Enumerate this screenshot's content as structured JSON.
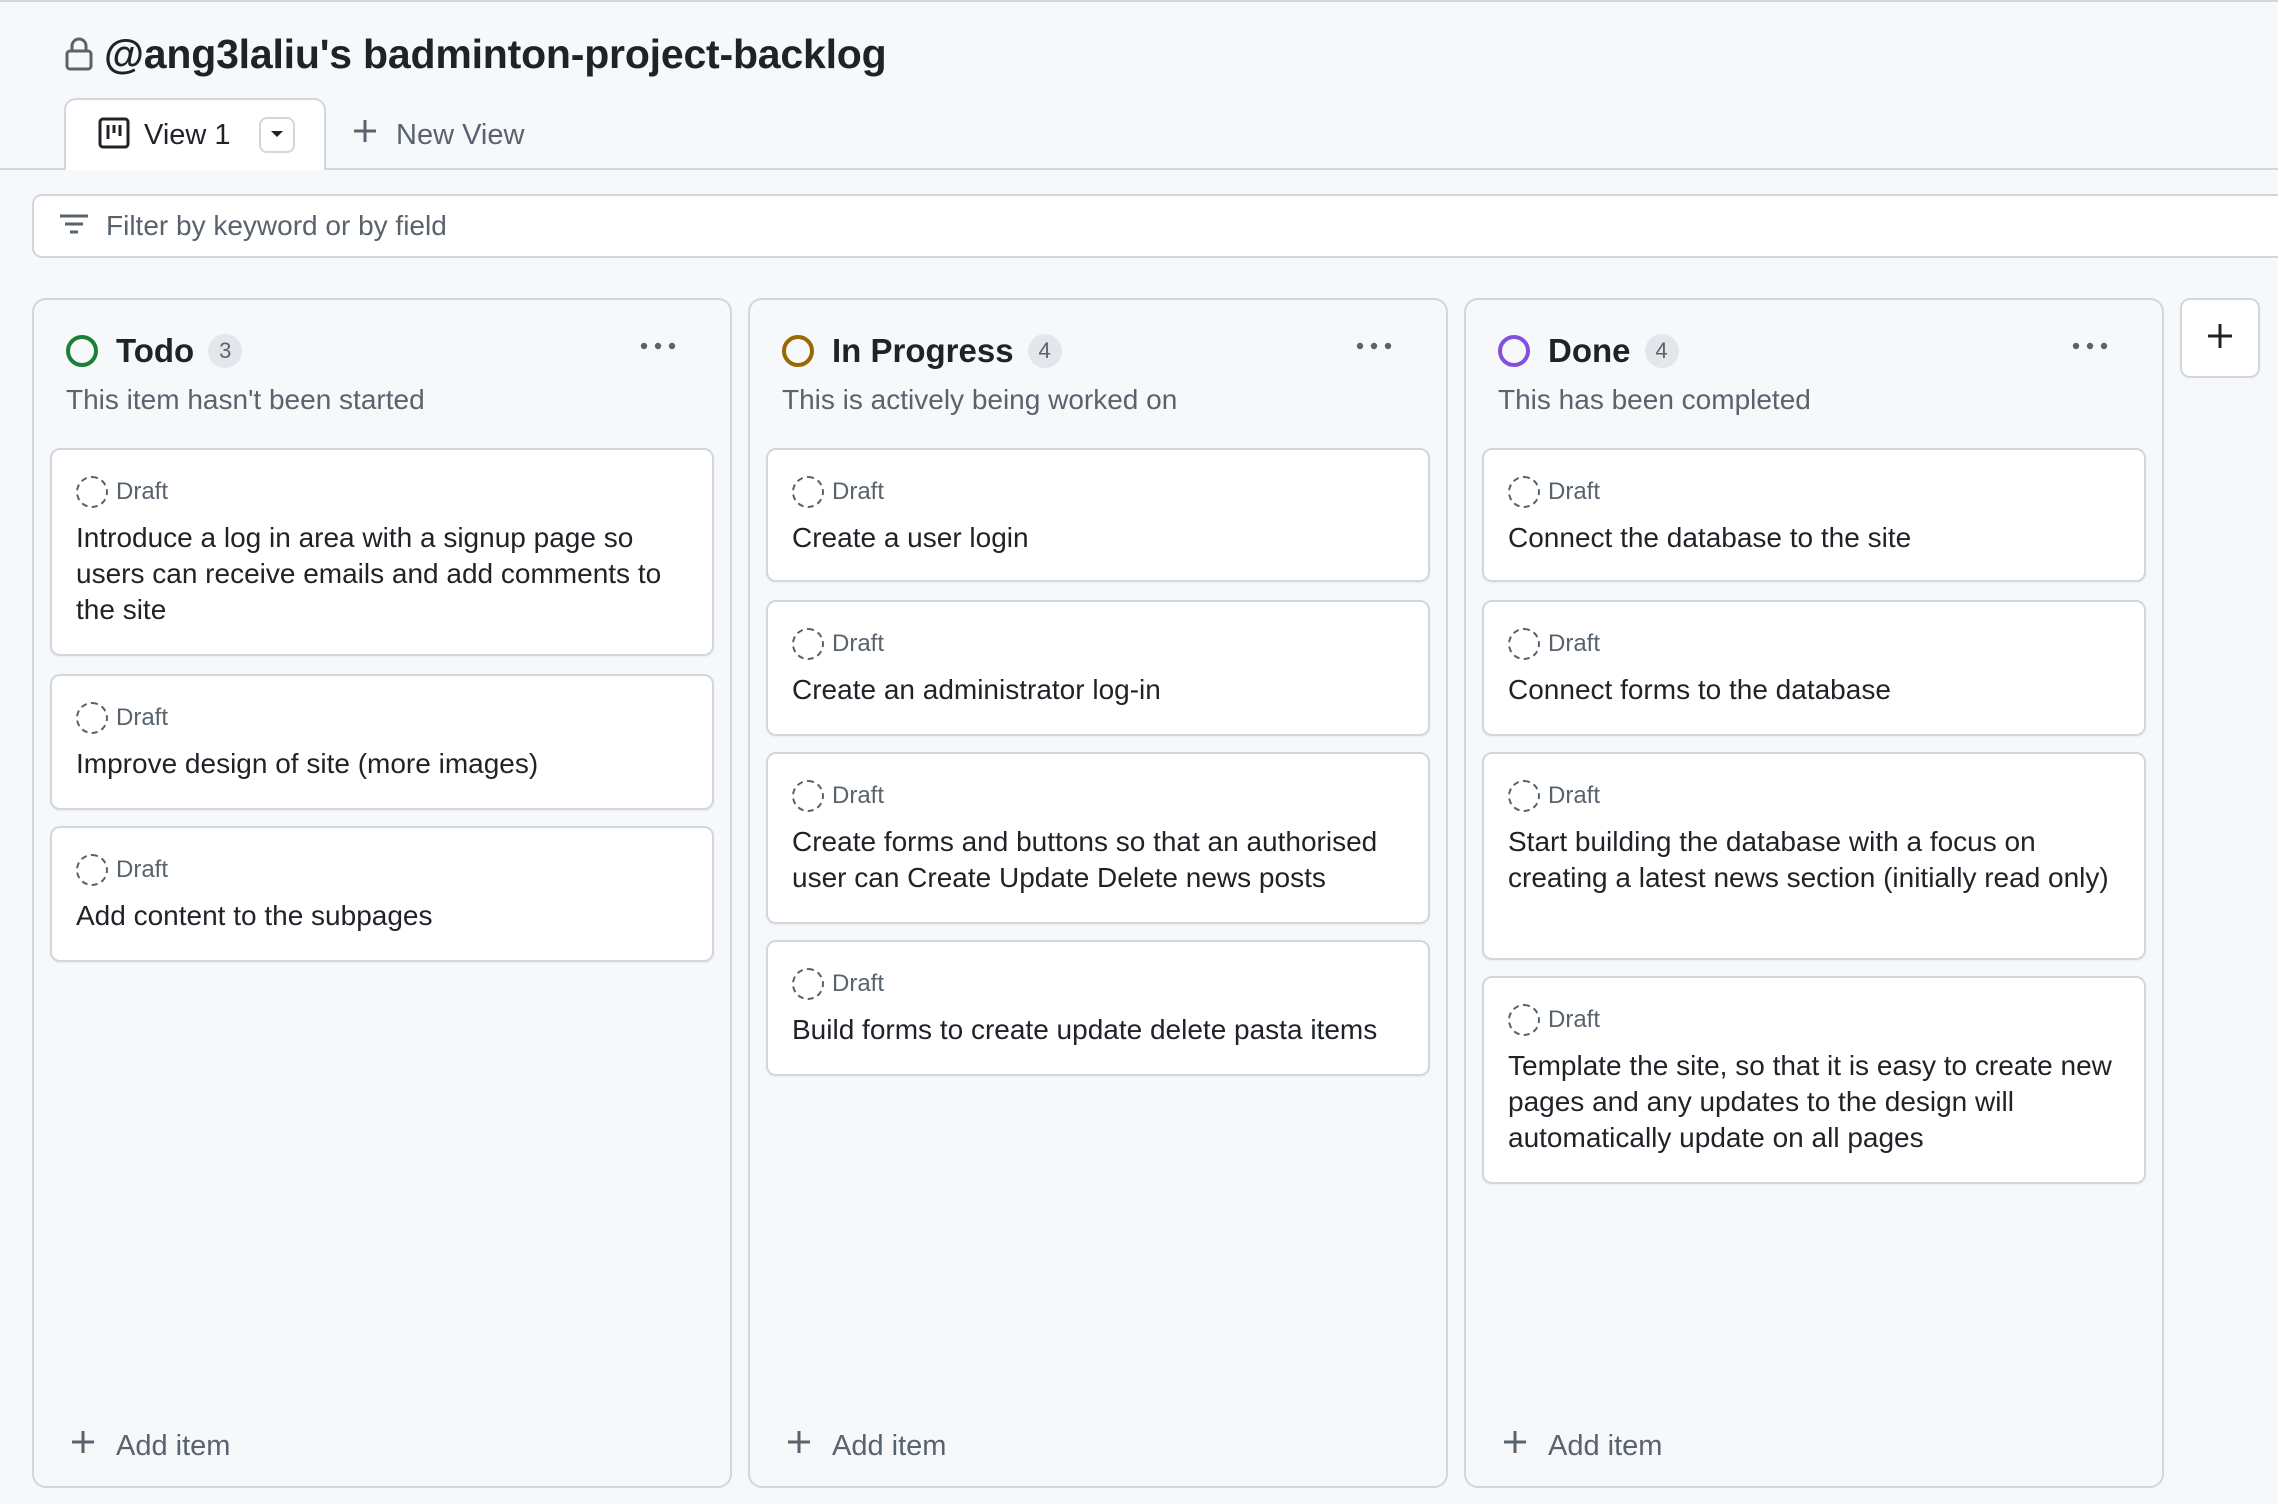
{
  "project": {
    "title": "@ang3laliu's badminton-project-backlog"
  },
  "tabs": {
    "active_label": "View 1",
    "new_view_label": "New View"
  },
  "filter": {
    "placeholder": "Filter by keyword or by field"
  },
  "columns": [
    {
      "title": "Todo",
      "count": "3",
      "description": "This item hasn't been started",
      "status_color": "#1a7f37",
      "add_label": "Add item",
      "cards": [
        {
          "badge": "Draft",
          "title": "Introduce a log in area with a signup page so users can receive emails and add comments to the site"
        },
        {
          "badge": "Draft",
          "title": "Improve design of site (more images)"
        },
        {
          "badge": "Draft",
          "title": "Add content to the subpages"
        }
      ]
    },
    {
      "title": "In Progress",
      "count": "4",
      "description": "This is actively being worked on",
      "status_color": "#9a6700",
      "add_label": "Add item",
      "cards": [
        {
          "badge": "Draft",
          "title": "Create a user login"
        },
        {
          "badge": "Draft",
          "title": "Create an administrator log-in"
        },
        {
          "badge": "Draft",
          "title": "Create forms and buttons so that an authorised user can Create Update Delete news posts"
        },
        {
          "badge": "Draft",
          "title": "Build forms to create update delete pasta items"
        }
      ]
    },
    {
      "title": "Done",
      "count": "4",
      "description": "This has been completed",
      "status_color": "#8250df",
      "add_label": "Add item",
      "cards": [
        {
          "badge": "Draft",
          "title": "Connect the database to the site"
        },
        {
          "badge": "Draft",
          "title": "Connect forms to the database"
        },
        {
          "badge": "Draft",
          "title": "Start building the database with a focus on creating a latest news section (initially read only)"
        },
        {
          "badge": "Draft",
          "title": "Template the site, so that it is easy to create new pages and any updates to the design will automatically update on all pages"
        }
      ]
    }
  ],
  "icons": {
    "lock": "lock-icon",
    "board": "board-view-icon",
    "caret": "caret-down-icon",
    "plus": "plus-icon",
    "filter": "filter-icon",
    "kebab": "kebab-horizontal-icon",
    "draft": "draft-issue-icon"
  }
}
